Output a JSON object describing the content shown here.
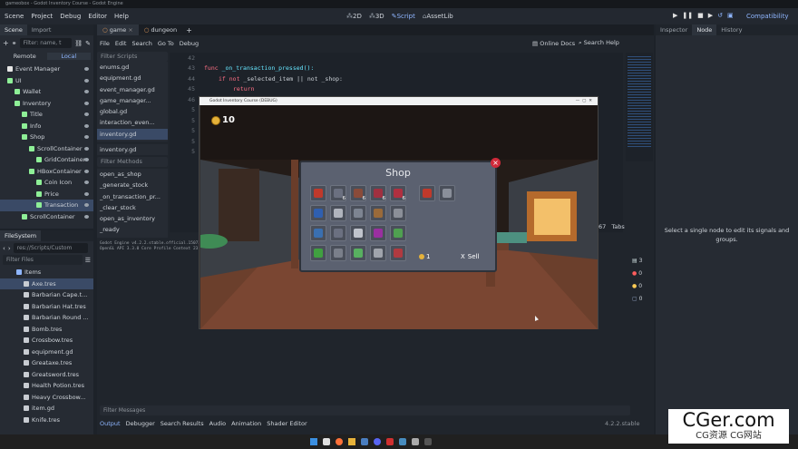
{
  "window": {
    "title": "gameobox - Godot Inventory Course - Godot Engine"
  },
  "menubar": {
    "items": [
      "Scene",
      "Project",
      "Debug",
      "Editor",
      "Help"
    ],
    "workspaces": [
      "2D",
      "3D",
      "Script",
      "AssetLib"
    ],
    "renderer": "Compatibility"
  },
  "scene_dock": {
    "tabs": [
      "Scene",
      "Import"
    ],
    "filter_placeholder": "Filter: name, t",
    "modes": [
      "Remote",
      "Local"
    ],
    "nodes": [
      {
        "label": "Event Manager",
        "indent": 0,
        "color": "#e6e6e6"
      },
      {
        "label": "UI",
        "indent": 0,
        "color": "#8eef97"
      },
      {
        "label": "Wallet",
        "indent": 1,
        "color": "#8eef97"
      },
      {
        "label": "Inventory",
        "indent": 1,
        "color": "#8eef97"
      },
      {
        "label": "Title",
        "indent": 2,
        "color": "#8eef97"
      },
      {
        "label": "Info",
        "indent": 2,
        "color": "#8eef97"
      },
      {
        "label": "Shop",
        "indent": 2,
        "color": "#8eef97"
      },
      {
        "label": "ScrollContainer",
        "indent": 3,
        "color": "#8eef97"
      },
      {
        "label": "GridContainer",
        "indent": 4,
        "color": "#8eef97"
      },
      {
        "label": "HBoxContainer",
        "indent": 3,
        "color": "#8eef97"
      },
      {
        "label": "Coin Icon",
        "indent": 4,
        "color": "#8eef97"
      },
      {
        "label": "Price",
        "indent": 4,
        "color": "#8eef97"
      },
      {
        "label": "Transaction",
        "indent": 4,
        "color": "#8eef97",
        "selected": true
      },
      {
        "label": "ScrollContainer",
        "indent": 2,
        "color": "#8eef97"
      }
    ]
  },
  "filesystem": {
    "tab": "FileSystem",
    "path": "res://Scripts/Custom",
    "filter_placeholder": "Filter Files",
    "items": [
      "Items",
      "Axe.tres",
      "Barbarian Cape.t...",
      "Barbarian Hat.tres",
      "Barbarian Round ...",
      "Bomb.tres",
      "Crossbow.tres",
      "equipment.gd",
      "Greataxe.tres",
      "Greatsword.tres",
      "Health Potion.tres",
      "Heavy Crossbow...",
      "item.gd",
      "Knife.tres"
    ]
  },
  "editor": {
    "tabs": [
      "game",
      "dungeon"
    ],
    "menu": [
      "File",
      "Edit",
      "Search",
      "Go To",
      "Debug"
    ],
    "right_links": [
      "Online Docs",
      "Search Help"
    ],
    "filter_scripts": "Filter Scripts",
    "scripts": [
      "enums.gd",
      "equipment.gd",
      "event_manager.gd",
      "game_manager...",
      "global.gd",
      "interaction_even...",
      "inventory.gd"
    ],
    "current_script": "inventory.gd",
    "filter_methods": "Filter Methods",
    "methods": [
      "open_as_shop",
      "_generate_stock",
      "_on_transaction_pr...",
      "_clear_stock",
      "open_as_inventory",
      "_ready"
    ],
    "code_lines": [
      {
        "n": "42",
        "text": ""
      },
      {
        "n": "43",
        "kw": "func",
        "rest": " _on_transaction_pressed():"
      },
      {
        "n": "44",
        "kw": "if not",
        "rest": " _selected_item || not _shop:"
      },
      {
        "n": "45",
        "kw": "return",
        "rest": ""
      },
      {
        "n": "46",
        "text": ""
      },
      {
        "n": "5",
        "text": ""
      },
      {
        "n": "5",
        "text": ""
      },
      {
        "n": "5",
        "text": ""
      },
      {
        "n": "5",
        "text": ""
      },
      {
        "n": "5",
        "text": ""
      }
    ],
    "status": {
      "col": "67",
      "indent": "Tabs"
    },
    "output_text": [
      "Godot Engine v4.2.2.stable.official.15073...",
      "OpenGL API 3.3.0 Core Profile Context 23..."
    ]
  },
  "game_window": {
    "title": "Godot Inventory Course (DEBUG)",
    "coins": "10",
    "shop_title": "Shop",
    "price": "1",
    "sell_label": "Sell",
    "slots": [
      {
        "color": "#c0392b",
        "count": ""
      },
      {
        "color": "#6b7080",
        "count": "6"
      },
      {
        "color": "#8a4b3a",
        "count": "6"
      },
      {
        "color": "#a03040",
        "count": "6"
      },
      {
        "color": "#b03040",
        "count": "6"
      },
      {
        "color": "#2f5fb0",
        "count": ""
      },
      {
        "color": "#b0b4bd",
        "count": ""
      },
      {
        "color": "#7d8491",
        "count": ""
      },
      {
        "color": "#9a6a3a",
        "count": ""
      },
      {
        "color": "#8b8f98",
        "count": ""
      },
      {
        "color": "#3a6fb0",
        "count": ""
      },
      {
        "color": "#6b7080",
        "count": ""
      },
      {
        "color": "#c0c4cc",
        "count": ""
      },
      {
        "color": "#9a2fa0",
        "count": ""
      },
      {
        "color": "#4fa050",
        "count": ""
      },
      {
        "color": "#40a040",
        "count": ""
      },
      {
        "color": "#7a7f8a",
        "count": ""
      },
      {
        "color": "#58b060",
        "count": ""
      },
      {
        "color": "#a0a4ac",
        "count": ""
      },
      {
        "color": "#b03a40",
        "count": ""
      }
    ],
    "side_slots": [
      {
        "color": "#c0392b"
      },
      {
        "color": "#8a8f9a"
      }
    ]
  },
  "inspector": {
    "tabs": [
      "Inspector",
      "Node",
      "History"
    ],
    "message": "Select a single node to edit its signals and groups.",
    "counts": [
      "3",
      "0",
      "0",
      "0"
    ]
  },
  "bottom_panel": {
    "filter": "Filter Messages",
    "tabs": [
      "Output",
      "Debugger",
      "Search Results",
      "Audio",
      "Animation",
      "Shader Editor"
    ],
    "version": "4.2.2.stable"
  },
  "watermark": {
    "brand": "CGer.com",
    "sub": "CG资源 CG网站"
  }
}
